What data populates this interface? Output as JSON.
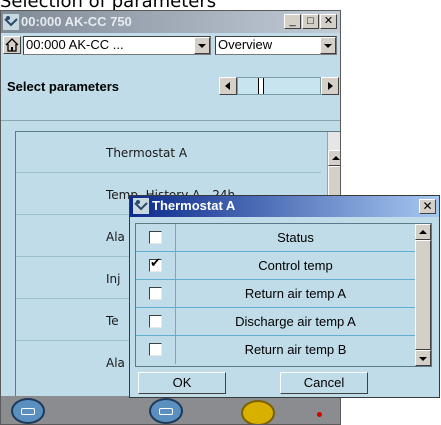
{
  "caption": "Selection of parameters",
  "main_window": {
    "title": "00:000 AK-CC 750",
    "minimize": "_",
    "maximize": "□",
    "close": "✕",
    "device_combo": "00:000 AK-CC ...",
    "view_combo": "Overview",
    "select_label": "Select parameters",
    "list_items": [
      "Thermostat A",
      "Temp. History A - 24h",
      "Ala",
      "Inj",
      "Te",
      "Ala"
    ]
  },
  "dialog": {
    "title": "Thermostat A",
    "close": "✕",
    "rows": [
      {
        "label": "Status",
        "checked": false
      },
      {
        "label": "Control temp",
        "checked": true
      },
      {
        "label": "Return air temp A",
        "checked": false
      },
      {
        "label": "Discharge air temp A",
        "checked": false
      },
      {
        "label": "Return air temp B",
        "checked": false
      }
    ],
    "ok_label": "OK",
    "cancel_label": "Cancel"
  },
  "icons": {
    "window_icon": "wrench-gauge-icon",
    "home_icon": "home-icon"
  }
}
